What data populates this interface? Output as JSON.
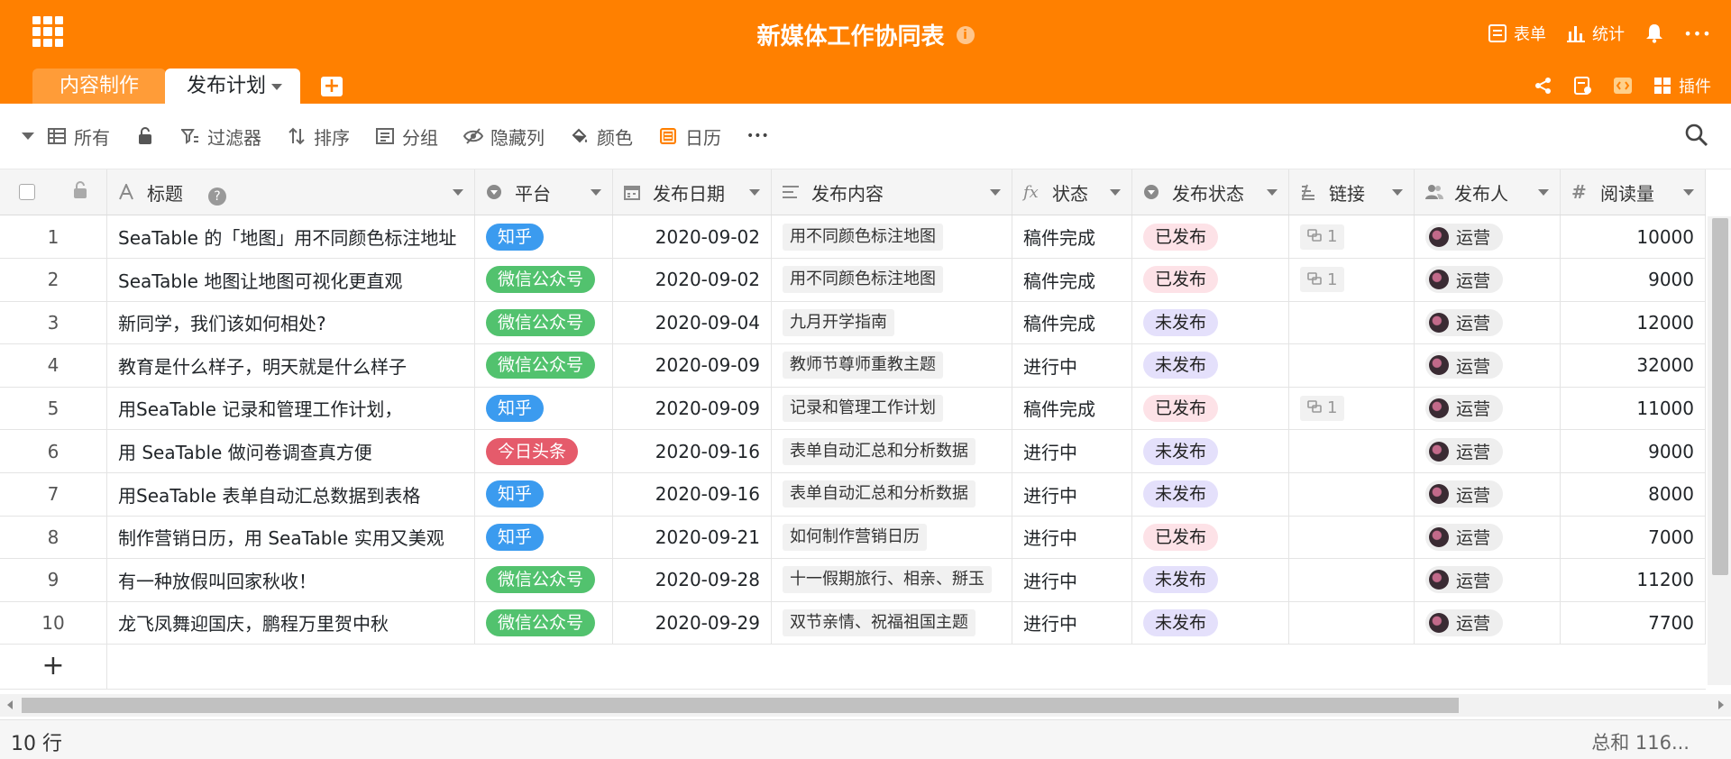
{
  "header": {
    "title": "新媒体工作协同表",
    "info": "i",
    "form_label": "表单",
    "stats_label": "统计",
    "more": "•••"
  },
  "tabs": [
    {
      "label": "内容制作"
    },
    {
      "label": "发布计划"
    }
  ],
  "tab_add": "+",
  "tab_right": {
    "plugins_label": "插件"
  },
  "toolbar": {
    "view_label": "所有",
    "filter_label": "过滤器",
    "sort_label": "排序",
    "group_label": "分组",
    "hide_label": "隐藏列",
    "color_label": "颜色",
    "calendar_label": "日历",
    "more": "•••"
  },
  "columns": {
    "title": "标题",
    "platform": "平台",
    "date": "发布日期",
    "content": "发布内容",
    "state": "状态",
    "publish_state": "发布状态",
    "link": "链接",
    "publisher": "发布人",
    "views": "阅读量"
  },
  "help_icon": "?",
  "colors": {
    "brand": "#ff8000",
    "zhihu": "#3b9bef",
    "wechat": "#52c26e",
    "toutiao": "#e55b6b",
    "published_bg": "#fde2e7",
    "unpublished_bg": "#e4e0fb"
  },
  "rows": [
    {
      "idx": "1",
      "title": "SeaTable 的「地图」用不同颜色标注地址",
      "platform": "知乎",
      "date": "2020-09-02",
      "content": "用不同颜色标注地图",
      "state": "稿件完成",
      "publish_state": "已发布",
      "link": "1",
      "publisher": "运营",
      "views": "10000"
    },
    {
      "idx": "2",
      "title": "SeaTable 地图让地图可视化更直观",
      "platform": "微信公众号",
      "date": "2020-09-02",
      "content": "用不同颜色标注地图",
      "state": "稿件完成",
      "publish_state": "已发布",
      "link": "1",
      "publisher": "运营",
      "views": "9000"
    },
    {
      "idx": "3",
      "title": "新同学，我们该如何相处?",
      "platform": "微信公众号",
      "date": "2020-09-04",
      "content": "九月开学指南",
      "state": "稿件完成",
      "publish_state": "未发布",
      "link": "",
      "publisher": "运营",
      "views": "12000"
    },
    {
      "idx": "4",
      "title": "教育是什么样子，明天就是什么样子",
      "platform": "微信公众号",
      "date": "2020-09-09",
      "content": "教师节尊师重教主题",
      "state": "进行中",
      "publish_state": "未发布",
      "link": "",
      "publisher": "运营",
      "views": "32000"
    },
    {
      "idx": "5",
      "title": "用SeaTable 记录和管理工作计划，",
      "platform": "知乎",
      "date": "2020-09-09",
      "content": "记录和管理工作计划",
      "state": "稿件完成",
      "publish_state": "已发布",
      "link": "1",
      "publisher": "运营",
      "views": "11000"
    },
    {
      "idx": "6",
      "title": "用 SeaTable 做问卷调查真方便",
      "platform": "今日头条",
      "date": "2020-09-16",
      "content": "表单自动汇总和分析数据",
      "state": "进行中",
      "publish_state": "未发布",
      "link": "",
      "publisher": "运营",
      "views": "9000"
    },
    {
      "idx": "7",
      "title": "用SeaTable 表单自动汇总数据到表格",
      "platform": "知乎",
      "date": "2020-09-16",
      "content": "表单自动汇总和分析数据",
      "state": "进行中",
      "publish_state": "未发布",
      "link": "",
      "publisher": "运营",
      "views": "8000"
    },
    {
      "idx": "8",
      "title": "制作营销日历，用 SeaTable 实用又美观",
      "platform": "知乎",
      "date": "2020-09-21",
      "content": "如何制作营销日历",
      "state": "进行中",
      "publish_state": "已发布",
      "link": "",
      "publisher": "运营",
      "views": "7000"
    },
    {
      "idx": "9",
      "title": "有一种放假叫回家秋收！",
      "platform": "微信公众号",
      "date": "2020-09-28",
      "content": "十一假期旅行、相亲、掰玉",
      "state": "进行中",
      "publish_state": "未发布",
      "link": "",
      "publisher": "运营",
      "views": "11200"
    },
    {
      "idx": "10",
      "title": "龙飞凤舞迎国庆，鹏程万里贺中秋",
      "platform": "微信公众号",
      "date": "2020-09-29",
      "content": "双节亲情、祝福祖国主题",
      "state": "进行中",
      "publish_state": "未发布",
      "link": "",
      "publisher": "运营",
      "views": "7700"
    }
  ],
  "add_row": "+",
  "footer": {
    "row_count": "10 行",
    "sum": "总和 116..."
  }
}
